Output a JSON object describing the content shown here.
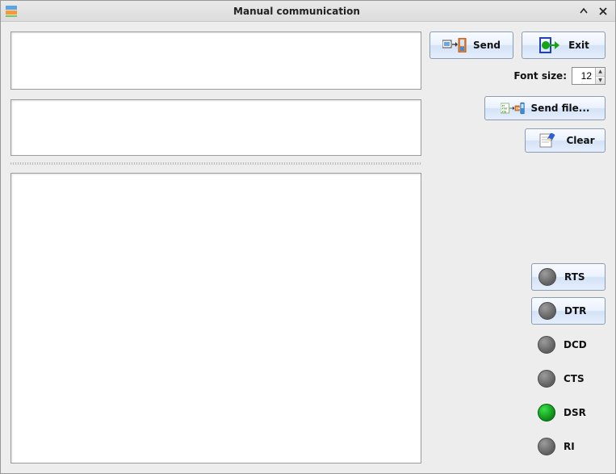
{
  "window": {
    "title": "Manual communication"
  },
  "buttons": {
    "send": "Send",
    "exit": "Exit",
    "sendfile": "Send file...",
    "clear": "Clear"
  },
  "font": {
    "label": "Font size:",
    "value": "12"
  },
  "input": {
    "top": "",
    "middle": "",
    "bottom": ""
  },
  "signals": [
    {
      "name": "RTS",
      "on": false,
      "toggle": true
    },
    {
      "name": "DTR",
      "on": false,
      "toggle": true
    },
    {
      "name": "DCD",
      "on": false,
      "toggle": false
    },
    {
      "name": "CTS",
      "on": false,
      "toggle": false
    },
    {
      "name": "DSR",
      "on": true,
      "toggle": false
    },
    {
      "name": "RI",
      "on": false,
      "toggle": false
    }
  ]
}
